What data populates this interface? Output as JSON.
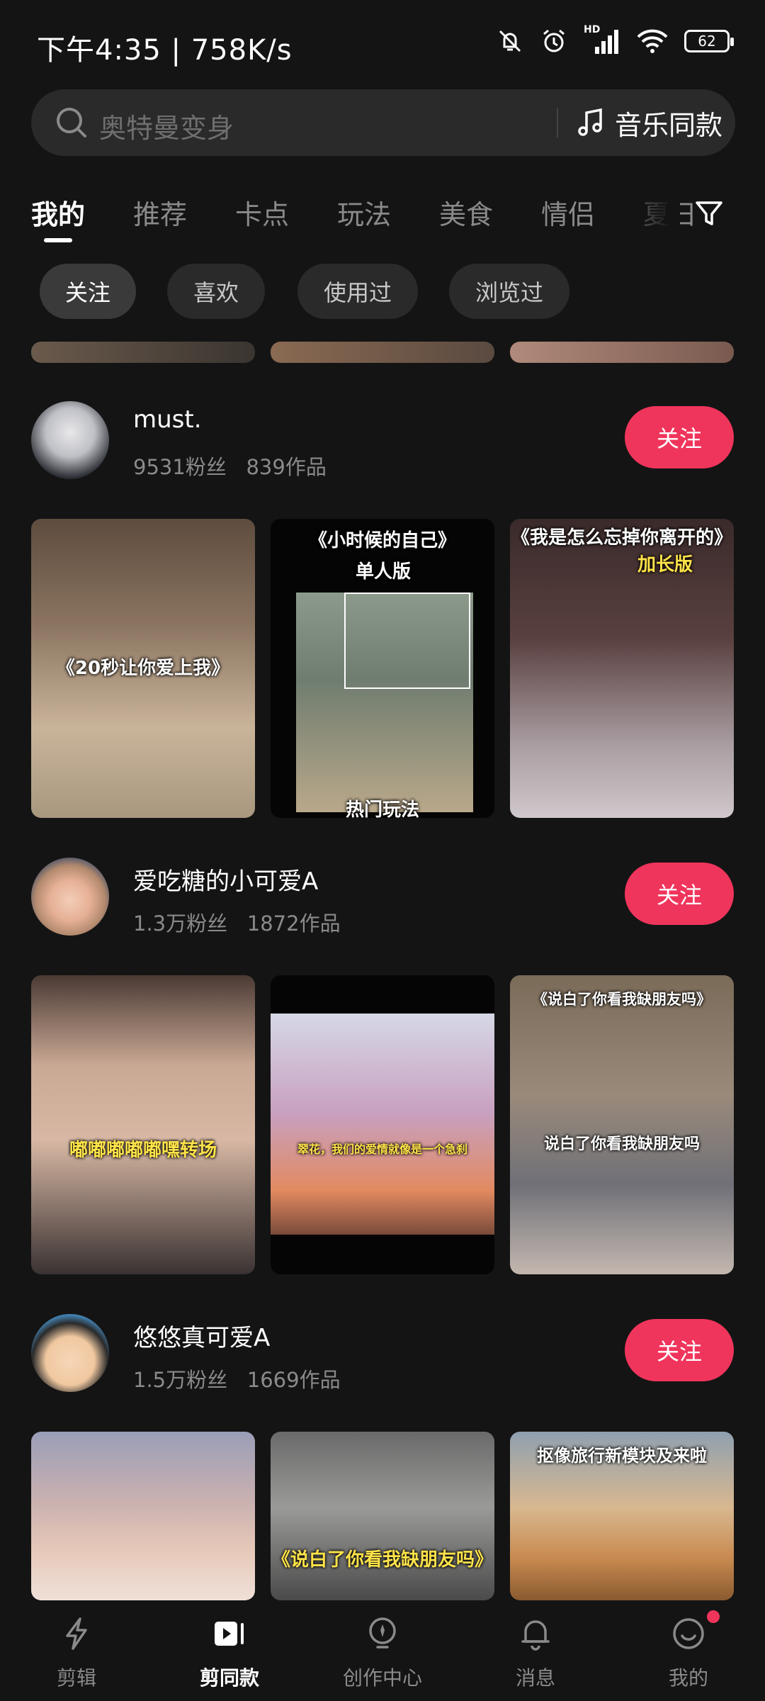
{
  "status_bar": {
    "time_speed": "下午4:35 | 758K/s",
    "network_type": "HD",
    "battery": "62"
  },
  "search": {
    "placeholder": "奥特曼变身",
    "music_label": "音乐同款"
  },
  "tabs": [
    "我的",
    "推荐",
    "卡点",
    "玩法",
    "美食",
    "情侣",
    "夏日"
  ],
  "chips": [
    "关注",
    "喜欢",
    "使用过",
    "浏览过"
  ],
  "follow_label": "关注",
  "creators": [
    {
      "name": "must.",
      "followers": "9531粉丝",
      "works": "839作品",
      "thumbs": [
        {
          "caption": "《20秒让你爱上我》",
          "caption2": ""
        },
        {
          "caption": "《小时候的自己》",
          "caption2": "单人版",
          "caption3": "热门玩法"
        },
        {
          "caption": "《我是怎么忘掉你离开的》",
          "caption2": "加长版"
        }
      ]
    },
    {
      "name": "爱吃糖的小可爱A",
      "followers": "1.3万粉丝",
      "works": "1872作品",
      "thumbs": [
        {
          "caption": "嘟嘟嘟嘟嘟嘿转场"
        },
        {
          "caption": "翠花，我们的爱情就像是一个急刹"
        },
        {
          "caption": "《说白了你看我缺朋友吗》",
          "caption2": "说白了你看我缺朋友吗"
        }
      ]
    },
    {
      "name": "悠悠真可爱A",
      "followers": "1.5万粉丝",
      "works": "1669作品",
      "thumbs": [
        {
          "caption": ""
        },
        {
          "caption": "《说白了你看我缺朋友吗》"
        },
        {
          "caption": "抠像旅行新模块及来啦"
        }
      ]
    }
  ],
  "bottom_nav": [
    "剪辑",
    "剪同款",
    "创作中心",
    "消息",
    "我的"
  ],
  "colors": {
    "background": "#141414",
    "accent": "#f0355c",
    "search_bg": "#2a2a2a"
  }
}
